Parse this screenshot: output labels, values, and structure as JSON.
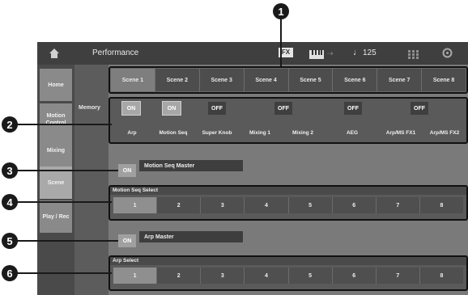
{
  "header": {
    "title": "Performance",
    "fx_label": "FX",
    "tempo_symbol": "♩",
    "tempo": "125"
  },
  "sidebar": {
    "items": [
      {
        "label": "Home"
      },
      {
        "label": "Motion Control"
      },
      {
        "label": "Mixing"
      },
      {
        "label": "Scene"
      },
      {
        "label": "Play / Rec"
      }
    ]
  },
  "subpanel": {
    "label": "Memory"
  },
  "scenes": [
    "Scene 1",
    "Scene 2",
    "Scene 3",
    "Scene 4",
    "Scene 5",
    "Scene 6",
    "Scene 7",
    "Scene 8"
  ],
  "memory": {
    "switches": [
      "ON",
      "ON",
      "OFF",
      "OFF",
      "OFF",
      "OFF"
    ],
    "labels": [
      "Arp",
      "Motion Seq",
      "Super Knob",
      "Mixing 1",
      "Mixing 2",
      "AEG",
      "Arp/MS FX1",
      "Arp/MS FX2"
    ]
  },
  "motion_seq_master": {
    "switch": "ON",
    "label": "Motion Seq Master"
  },
  "motion_seq_select": {
    "title": "Motion Seq Select",
    "buttons": [
      "1",
      "2",
      "3",
      "4",
      "5",
      "6",
      "7",
      "8"
    ]
  },
  "arp_master": {
    "switch": "ON",
    "label": "Arp Master"
  },
  "arp_select": {
    "title": "Arp Select",
    "buttons": [
      "1",
      "2",
      "3",
      "4",
      "5",
      "6",
      "7",
      "8"
    ]
  },
  "callouts": [
    "1",
    "2",
    "3",
    "4",
    "5",
    "6"
  ]
}
